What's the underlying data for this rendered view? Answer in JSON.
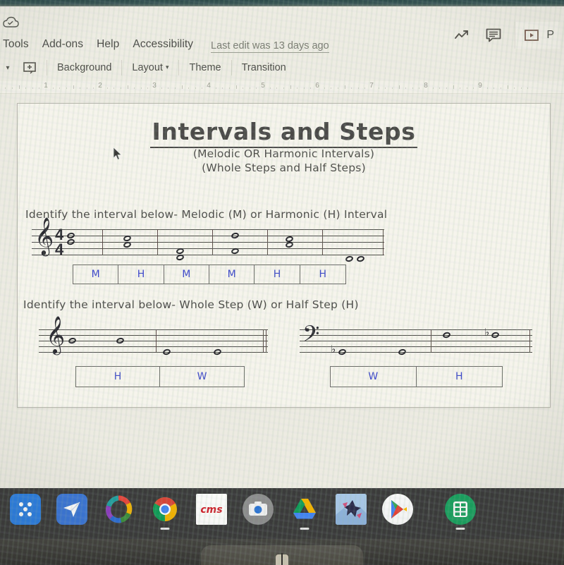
{
  "app": {
    "name": "Google Slides",
    "cloud_icon": "cloud-saved-icon"
  },
  "menubar": {
    "items": [
      "Tools",
      "Add-ons",
      "Help",
      "Accessibility"
    ],
    "last_edit": "Last edit was 13 days ago",
    "right_icons": [
      "trending-up-icon",
      "comment-icon"
    ],
    "present_label": "P",
    "present_icon": "present-play-icon"
  },
  "toolbar": {
    "caret": "▾",
    "new_slide_icon": "new-slide-icon",
    "buttons": [
      "Background",
      "Layout",
      "Theme",
      "Transition"
    ],
    "layout_caret": "▾"
  },
  "ruler": {
    "numbers": [
      "1",
      "2",
      "3",
      "4",
      "5",
      "6",
      "7",
      "8",
      "9"
    ]
  },
  "slide": {
    "title": "Intervals and Steps",
    "subtitle1": "(Melodic OR Harmonic Intervals)",
    "subtitle2": "(Whole Steps and Half Steps)",
    "prompt1": "Identify the interval below- Melodic (M) or Harmonic (H) Interval",
    "prompt2": "Identify the interval below- Whole Step (W) or Half Step (H)",
    "staff1": {
      "clef": "treble-clef",
      "time_signature": "4/4",
      "measures": 6
    },
    "answers1": [
      "M",
      "H",
      "M",
      "M",
      "H",
      "H"
    ],
    "staff2_left": {
      "clef": "treble-clef",
      "measures": 2
    },
    "answers2_left": [
      "H",
      "W"
    ],
    "staff2_right": {
      "clef": "bass-clef",
      "measures": 2
    },
    "answers2_right": [
      "W",
      "H"
    ],
    "answer_ink_color": "#3b46c9"
  },
  "cursor": {
    "icon": "mouse-pointer-icon"
  },
  "shelf": {
    "apps": [
      {
        "name": "launcher-icon"
      },
      {
        "name": "play-movies-icon"
      },
      {
        "name": "color-ring-icon"
      },
      {
        "name": "chrome-icon"
      },
      {
        "name": "cms-icon"
      },
      {
        "name": "camera-icon"
      },
      {
        "name": "google-drive-icon"
      },
      {
        "name": "photos-dancer-icon"
      },
      {
        "name": "play-store-icon"
      },
      {
        "name": "sheets-calculator-icon"
      }
    ]
  }
}
